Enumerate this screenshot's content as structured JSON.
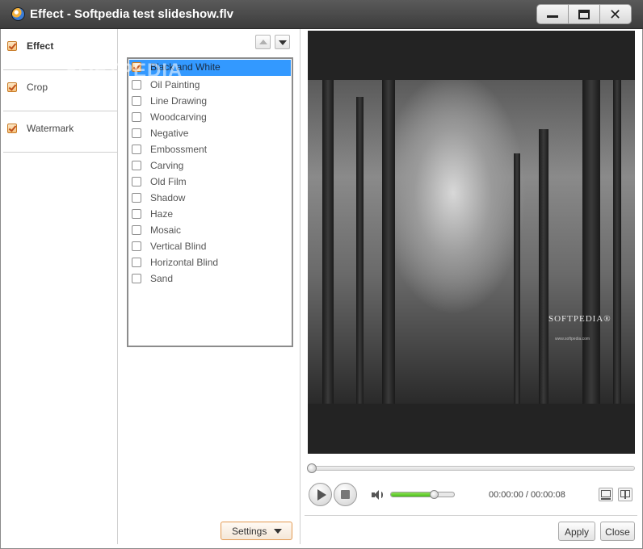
{
  "window": {
    "title": "Effect - Softpedia test slideshow.flv",
    "controls": {
      "minimize": "minimize",
      "maximize": "maximize",
      "close": "close"
    }
  },
  "sidebar": {
    "items": [
      {
        "label": "Effect",
        "checked": true,
        "active": true
      },
      {
        "label": "Crop",
        "checked": true,
        "active": false
      },
      {
        "label": "Watermark",
        "checked": true,
        "active": false
      }
    ]
  },
  "effects": {
    "items": [
      {
        "label": "Black and White",
        "checked": true,
        "selected": true
      },
      {
        "label": "Oil Painting",
        "checked": false
      },
      {
        "label": "Line Drawing",
        "checked": false
      },
      {
        "label": "Woodcarving",
        "checked": false
      },
      {
        "label": "Negative",
        "checked": false
      },
      {
        "label": "Embossment",
        "checked": false
      },
      {
        "label": "Carving",
        "checked": false
      },
      {
        "label": "Old Film",
        "checked": false
      },
      {
        "label": "Shadow",
        "checked": false
      },
      {
        "label": "Haze",
        "checked": false
      },
      {
        "label": "Mosaic",
        "checked": false
      },
      {
        "label": "Vertical Blind",
        "checked": false
      },
      {
        "label": "Horizontal Blind",
        "checked": false
      },
      {
        "label": "Sand",
        "checked": false
      }
    ],
    "settings_label": "Settings",
    "overlay_watermark": "SOFTPEDIA"
  },
  "preview": {
    "watermark_text": "SOFTPEDIA®",
    "watermark_url": "www.softpedia.com"
  },
  "player": {
    "seek_position": 0,
    "volume": 0.68,
    "time": "00:00:00 / 00:00:08"
  },
  "footer": {
    "apply_label": "Apply",
    "close_label": "Close"
  },
  "colors": {
    "selection": "#3399ff",
    "volume_fill": "#4bbf19",
    "settings_border": "#e39a52"
  }
}
